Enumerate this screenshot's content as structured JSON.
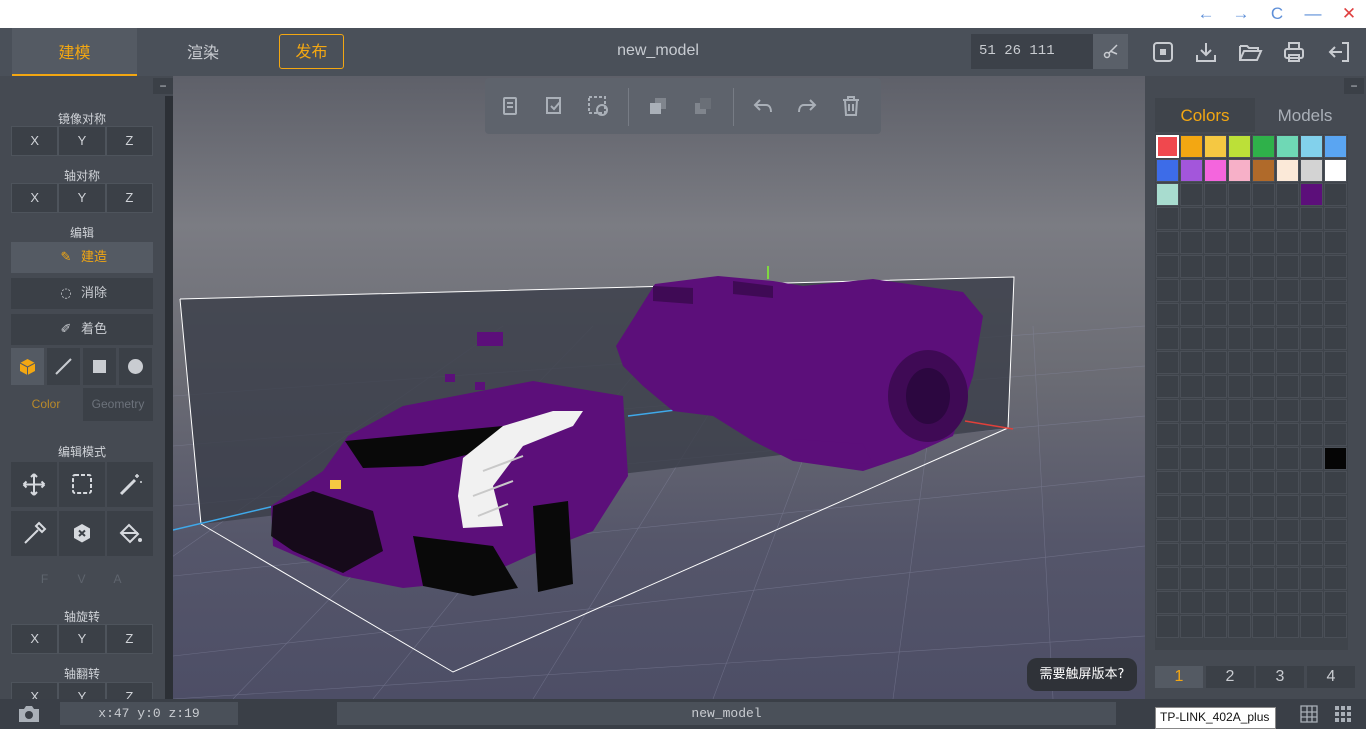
{
  "window": {
    "controls": [
      {
        "name": "back",
        "glyph": "←"
      },
      {
        "name": "forward",
        "glyph": "→"
      },
      {
        "name": "refresh",
        "glyph": "C"
      },
      {
        "name": "minimize",
        "glyph": "—"
      },
      {
        "name": "close",
        "glyph": "✕"
      }
    ]
  },
  "header": {
    "tabs": [
      {
        "label": "建模"
      },
      {
        "label": "渲染"
      }
    ],
    "publish_label": "发布",
    "title": "new_model",
    "coord_value": "51 26 111",
    "actions": [
      "save-icon",
      "download-icon",
      "folder-open-icon",
      "print-icon",
      "exit-icon"
    ]
  },
  "left_panel": {
    "collapse_glyph": "−",
    "mirror_label": "镜像对称",
    "axis_sym_label": "轴对称",
    "edit_label": "编辑",
    "axes": [
      "X",
      "Y",
      "Z"
    ],
    "tools": [
      {
        "label": "建造"
      },
      {
        "label": "消除"
      },
      {
        "label": "着色"
      }
    ],
    "shapes": [
      "cube-icon",
      "line-icon",
      "square-icon",
      "sphere-icon"
    ],
    "color_tab": "Color",
    "geometry_tab": "Geometry",
    "edit_mode_label": "编辑模式",
    "modes": [
      "move-icon",
      "select-box-icon",
      "magic-wand-icon",
      "eyedropper-icon",
      "delete-hex-icon",
      "paint-bucket-icon"
    ],
    "fva": [
      "F",
      "V",
      "A"
    ],
    "axis_rotate_label": "轴旋转",
    "axis_flip_label": "轴翻转"
  },
  "viewport": {
    "toolbar": [
      "copy-icon",
      "paste-icon",
      "cut-select-icon",
      "layer-front-icon",
      "layer-back-icon",
      "undo-icon",
      "redo-icon",
      "trash-icon"
    ],
    "touch_hint": "需要触屏版本?"
  },
  "right_panel": {
    "tabs": [
      {
        "label": "Colors"
      },
      {
        "label": "Models"
      }
    ],
    "palette": [
      "#f0484e",
      "#f3a712",
      "#f5c842",
      "#bce038",
      "#2fb14a",
      "#6fd8b5",
      "#82d1ec",
      "#5aa5f2",
      "#3d6ce8",
      "#a356db",
      "#f465dd",
      "#f7b0c8",
      "#b06a2a",
      "#fbe9d8",
      "#d3d3d3",
      "#ffffff",
      "#a8dccf"
    ],
    "custom_color": "#5c0f7a",
    "black_color": "#050505",
    "pages": [
      "1",
      "2",
      "3",
      "4"
    ]
  },
  "statusbar": {
    "cursor_pos": "x:47 y:0 z:19",
    "filename": "new_model",
    "tooltip": "TP-LINK_402A_plus"
  },
  "model": {
    "colors": {
      "primary": "#5c0f7a",
      "dark": "#090909",
      "light": "#f1f1f1",
      "accent": "#f5c842"
    }
  }
}
